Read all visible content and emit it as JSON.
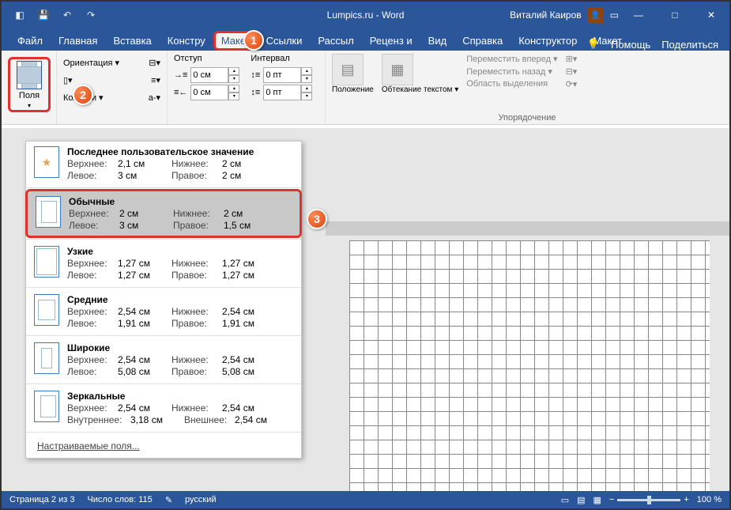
{
  "title": "Lumpics.ru - Word",
  "user": "Виталий Каиров",
  "window": {
    "min": "—",
    "max": "□",
    "close": "✕"
  },
  "tabs": [
    "Файл",
    "Главная",
    "Вставка",
    "Констру",
    "Макет",
    "Ссылки",
    "Рассыл",
    "Реценз и",
    "Вид",
    "Справка",
    "Конструктор",
    "Макет"
  ],
  "tabs_active_index": 4,
  "tabs_right": {
    "help_icon": "?",
    "help": "Помощь",
    "share": "Поделиться"
  },
  "ribbon": {
    "margins_label": "Поля",
    "orientation": "Ориентация ▾",
    "columns": "Колонки ▾",
    "indent_label": "Отступ",
    "interval_label": "Интервал",
    "indent_left": "0 см",
    "indent_right": "0 см",
    "interval_before": "0 пт",
    "interval_after": "0 пт",
    "position": "Положение",
    "wrap": "Обтекание текстом ▾",
    "bring_forward": "Переместить вперед ▾",
    "send_backward": "Переместить назад ▾",
    "selection_pane": "Область выделения",
    "arrange_label": "Упорядочение"
  },
  "margins_menu": {
    "last_custom": {
      "title": "Последнее пользовательское значение",
      "top_l": "Верхнее:",
      "top_v": "2,1 см",
      "bot_l": "Нижнее:",
      "bot_v": "2 см",
      "left_l": "Левое:",
      "left_v": "3 см",
      "right_l": "Правое:",
      "right_v": "2 см"
    },
    "normal": {
      "title": "Обычные",
      "top_l": "Верхнее:",
      "top_v": "2 см",
      "bot_l": "Нижнее:",
      "bot_v": "2 см",
      "left_l": "Левое:",
      "left_v": "3 см",
      "right_l": "Правое:",
      "right_v": "1,5 см"
    },
    "narrow": {
      "title": "Узкие",
      "top_l": "Верхнее:",
      "top_v": "1,27 см",
      "bot_l": "Нижнее:",
      "bot_v": "1,27 см",
      "left_l": "Левое:",
      "left_v": "1,27 см",
      "right_l": "Правое:",
      "right_v": "1,27 см"
    },
    "moderate": {
      "title": "Средние",
      "top_l": "Верхнее:",
      "top_v": "2,54 см",
      "bot_l": "Нижнее:",
      "bot_v": "2,54 см",
      "left_l": "Левое:",
      "left_v": "1,91 см",
      "right_l": "Правое:",
      "right_v": "1,91 см"
    },
    "wide": {
      "title": "Широкие",
      "top_l": "Верхнее:",
      "top_v": "2,54 см",
      "bot_l": "Нижнее:",
      "bot_v": "2,54 см",
      "left_l": "Левое:",
      "left_v": "5,08 см",
      "right_l": "Правое:",
      "right_v": "5,08 см"
    },
    "mirror": {
      "title": "Зеркальные",
      "top_l": "Верхнее:",
      "top_v": "2,54 см",
      "bot_l": "Нижнее:",
      "bot_v": "2,54 см",
      "left_l": "Внутреннее:",
      "left_v": "3,18 см",
      "right_l": "Внешнее:",
      "right_v": "2,54 см"
    },
    "custom": "Настраиваемые поля..."
  },
  "status": {
    "page": "Страница 2 из 3",
    "words": "Число слов: 115",
    "lang": "русский",
    "zoom": "100 %"
  },
  "callouts": {
    "one": "1",
    "two": "2",
    "three": "3"
  }
}
